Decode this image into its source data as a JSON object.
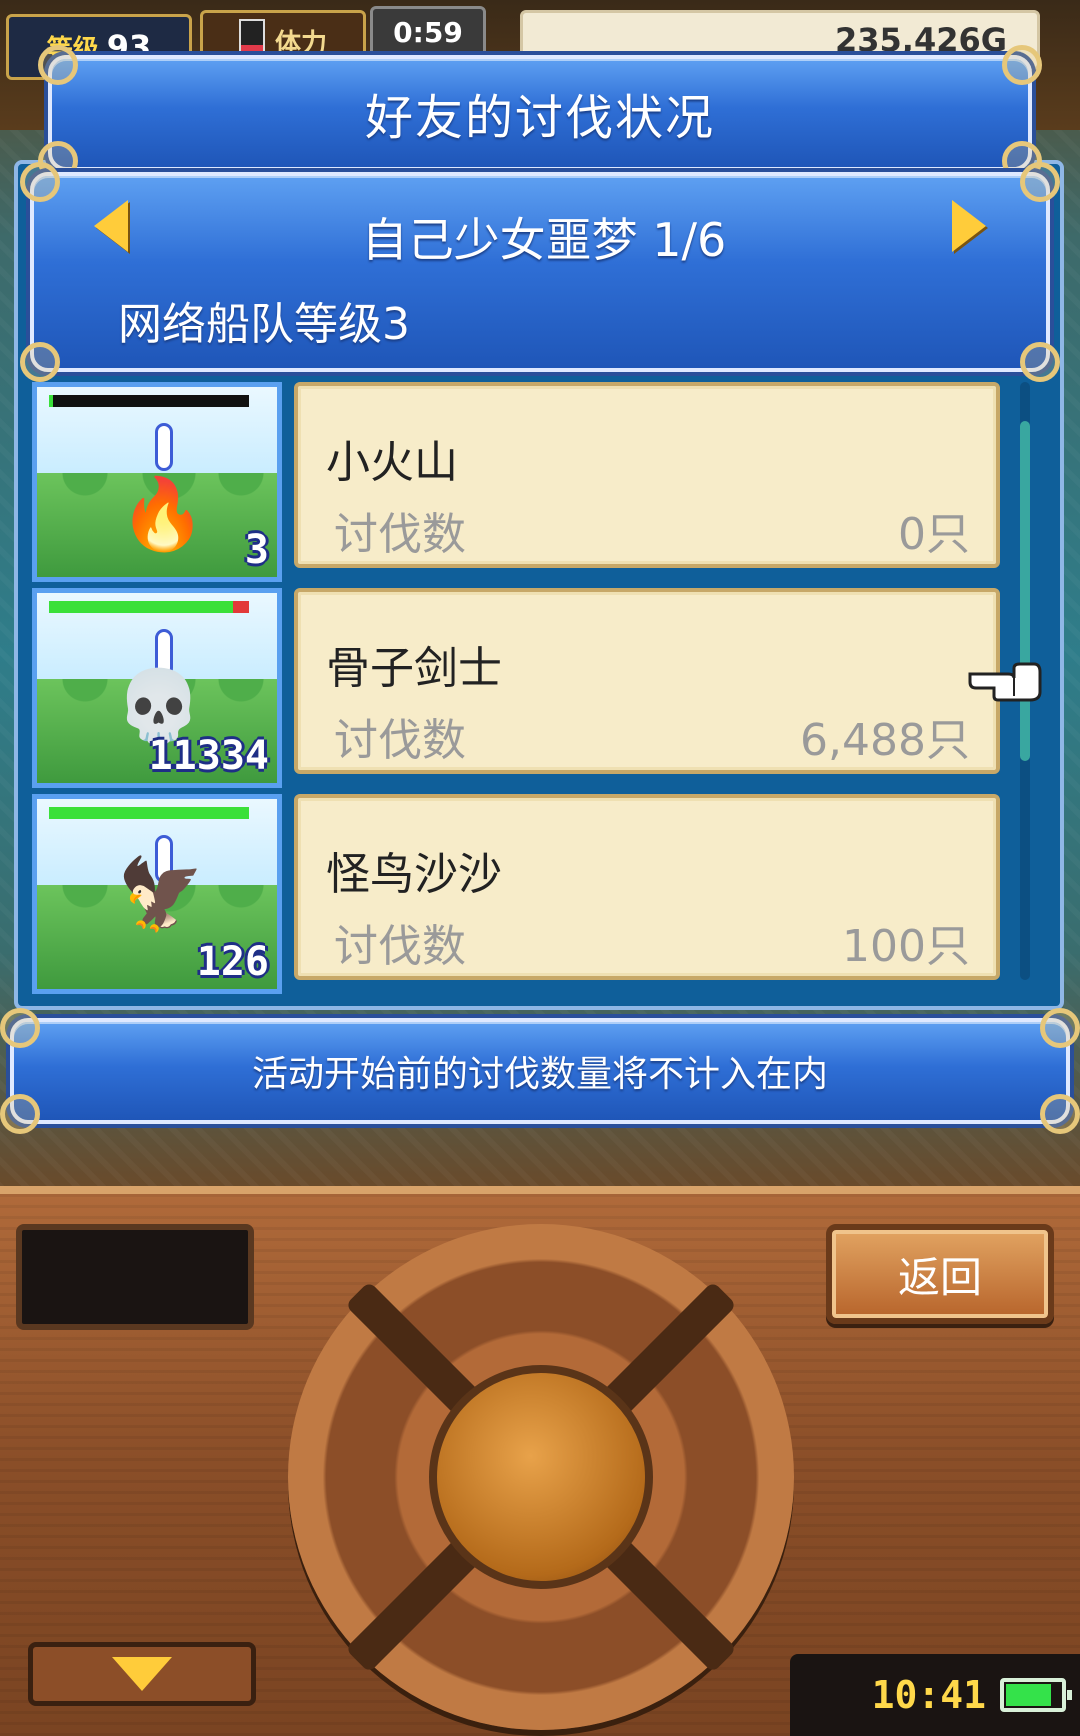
{
  "hud": {
    "level_label": "等级",
    "level_value": "93",
    "stamina_label": "体力",
    "timer": "0:59",
    "gold": "235,426G"
  },
  "dialog": {
    "title": "好友的讨伐状况",
    "page_label": "自己少女噩梦 1/6",
    "fleet_label": "网络船队等级3",
    "footer_note": "活动开始前的讨伐数量将不计入在内"
  },
  "monsters": [
    {
      "name": "小火山",
      "kill_label": "讨伐数",
      "kill_value": "0只",
      "thumb_count": "3",
      "hp_fraction": 0.02,
      "icon": "fire-monster-icon",
      "glyph": "🔥"
    },
    {
      "name": "骨子剑士",
      "kill_label": "讨伐数",
      "kill_value": "6,488只",
      "thumb_count": "11334",
      "hp_fraction": 0.92,
      "icon": "skeleton-swordsman-icon",
      "glyph": "💀"
    },
    {
      "name": "怪鸟沙沙",
      "kill_label": "讨伐数",
      "kill_value": "100只",
      "thumb_count": "126",
      "hp_fraction": 1.0,
      "icon": "strange-bird-icon",
      "glyph": "🦅"
    }
  ],
  "scroll_position": 0.15,
  "console": {
    "back_label": "返回",
    "clock": "10:41",
    "battery_level": 0.85
  },
  "colors": {
    "panel_blue": "#2f6fd6",
    "card_bg": "#f7ecc9",
    "gold_trim": "#e6c77a",
    "wood": "#8a4e28"
  }
}
